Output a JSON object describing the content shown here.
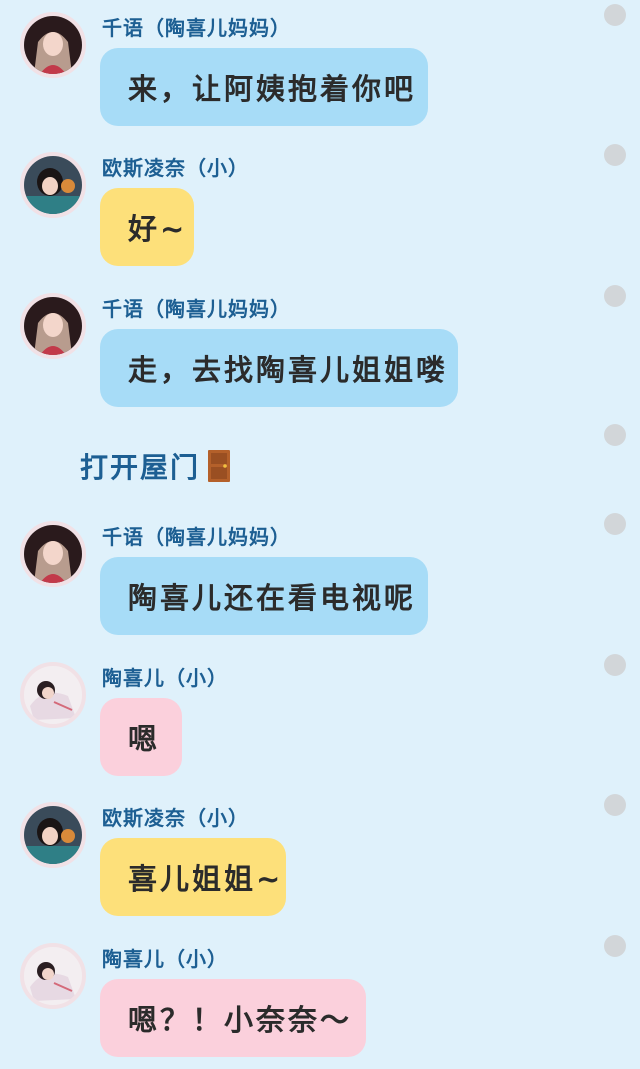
{
  "messages": [
    {
      "name": "千语（陶喜儿妈妈）",
      "text": "来，让阿姨抱着你吧",
      "avatar": "qianyu-avatar"
    },
    {
      "name": "欧斯凌奈（小）",
      "text": "好~",
      "avatar": "ousi-avatar"
    },
    {
      "name": "千语（陶喜儿妈妈）",
      "text": "走，去找陶喜儿姐姐喽",
      "avatar": "qianyu-avatar"
    },
    {
      "name": "千语（陶喜儿妈妈）",
      "text": "陶喜儿还在看电视呢",
      "avatar": "qianyu-avatar"
    },
    {
      "name": "陶喜儿（小）",
      "text": "嗯",
      "avatar": "taoxier-avatar"
    },
    {
      "name": "欧斯凌奈（小）",
      "text": "喜儿姐姐~",
      "avatar": "ousi-avatar"
    },
    {
      "name": "陶喜儿（小）",
      "text": "嗯？！小奈奈～",
      "avatar": "taoxier-avatar"
    }
  ],
  "narration": {
    "text": "打开屋门",
    "icon": "door-icon"
  },
  "colors": {
    "background": "#dff1fb",
    "bubble_blue": "#a7dcf7",
    "bubble_yellow": "#fde07a",
    "bubble_pink": "#fbd0dc",
    "name_color": "#1d5f93"
  }
}
